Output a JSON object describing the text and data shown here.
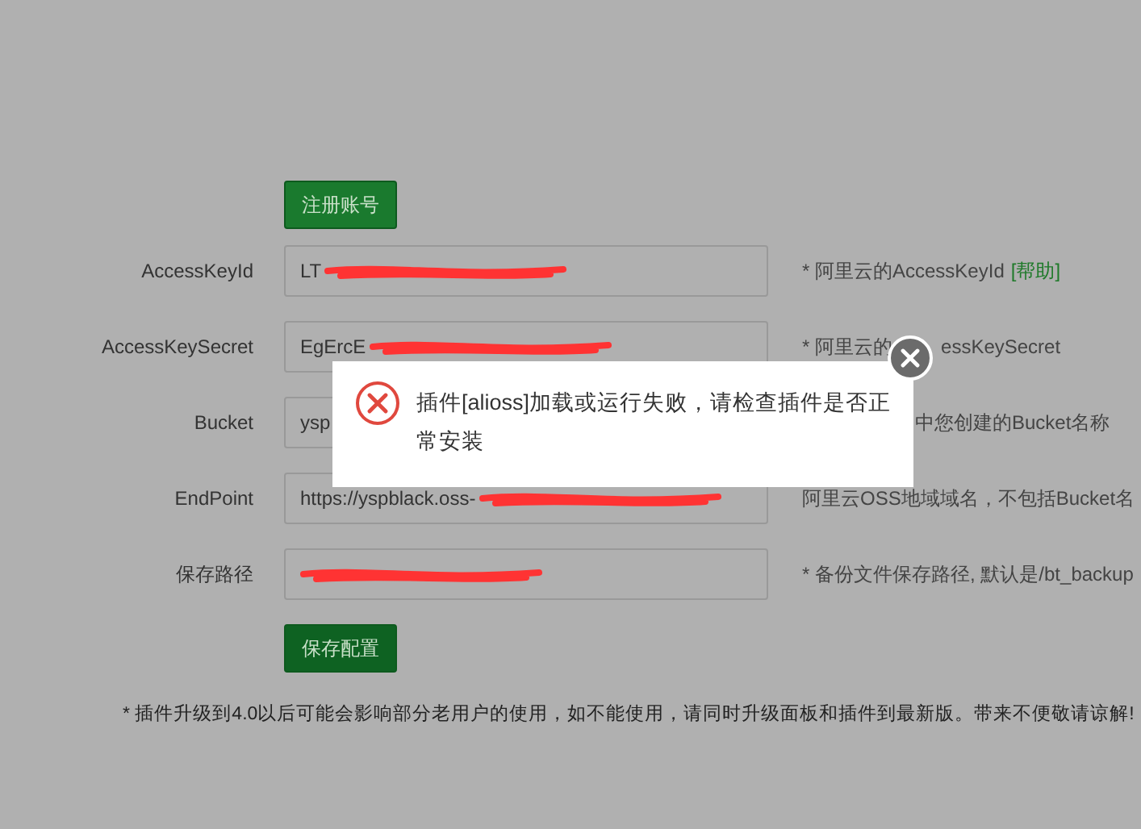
{
  "register_button": "注册账号",
  "fields": [
    {
      "label": "AccessKeyId",
      "value": "LT",
      "redacted": true,
      "hint": "* 阿里云的AccessKeyId",
      "help_link": "[帮助]"
    },
    {
      "label": "AccessKeySecret",
      "value": "EgErcE",
      "redacted": true,
      "hint": "* 阿里云的",
      "hint_tail": "essKeySecret"
    },
    {
      "label": "Bucket",
      "value": "ysp",
      "redacted": false,
      "hint": "中您创建的Bucket名称"
    },
    {
      "label": "EndPoint",
      "value": "https://yspblack.oss-",
      "redacted": true,
      "hint": "阿里云OSS地域域名，不包括Bucket名"
    },
    {
      "label": "保存路径",
      "redacted": true,
      "hint": "* 备份文件保存路径, 默认是/bt_backup"
    }
  ],
  "save_button": "保存配置",
  "note": "* 插件升级到4.0以后可能会影响部分老用户的使用，如不能使用，请同时升级面板和插件到最新版。带来不便敬请谅解!",
  "dialog": {
    "message": "插件[alioss]加载或运行失败，请检查插件是否正常安装"
  }
}
